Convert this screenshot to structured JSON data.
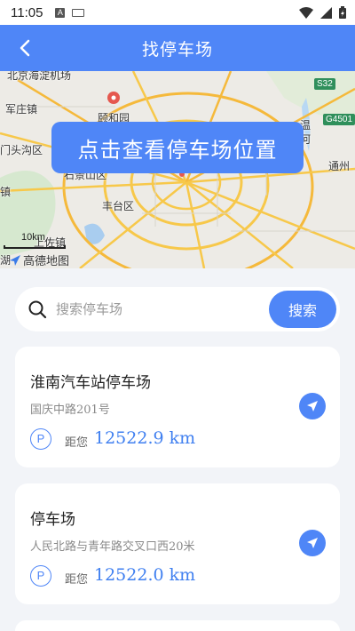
{
  "status_bar": {
    "time": "11:05",
    "left_icons": [
      "a-notification-icon",
      "keyboard-icon"
    ],
    "right_icons": [
      "wifi-icon",
      "signal-icon",
      "battery-icon"
    ]
  },
  "header": {
    "title": "找停车场",
    "back_icon": "back-arrow-icon",
    "background": "#4f86f7"
  },
  "map": {
    "labels": [
      "北京海淀机场",
      "军庄镇",
      "颐和园",
      "门头沟区",
      "石景山区",
      "镇",
      "丰台区",
      "通州",
      "上佐镇",
      "湖",
      "温",
      "河"
    ],
    "road_badges": [
      "S32",
      "G4501"
    ],
    "overlay_button": "点击查看停车场位置",
    "scale": "10km",
    "logo": "高德地图"
  },
  "search": {
    "placeholder": "搜索停车场",
    "value": "",
    "button_label": "搜索"
  },
  "parking_lots": [
    {
      "name": "淮南汽车站停车场",
      "address": "国庆中路201号",
      "p_label": "P",
      "distance_label": "距您",
      "distance": "12522.9 km"
    },
    {
      "name": "停车场",
      "address": "人民北路与青年路交叉口西20米",
      "p_label": "P",
      "distance_label": "距您",
      "distance": "12522.0 km"
    }
  ],
  "colors": {
    "accent": "#4f86f7",
    "distance": "#3f7ff0",
    "page_bg": "#f2f4f8"
  }
}
